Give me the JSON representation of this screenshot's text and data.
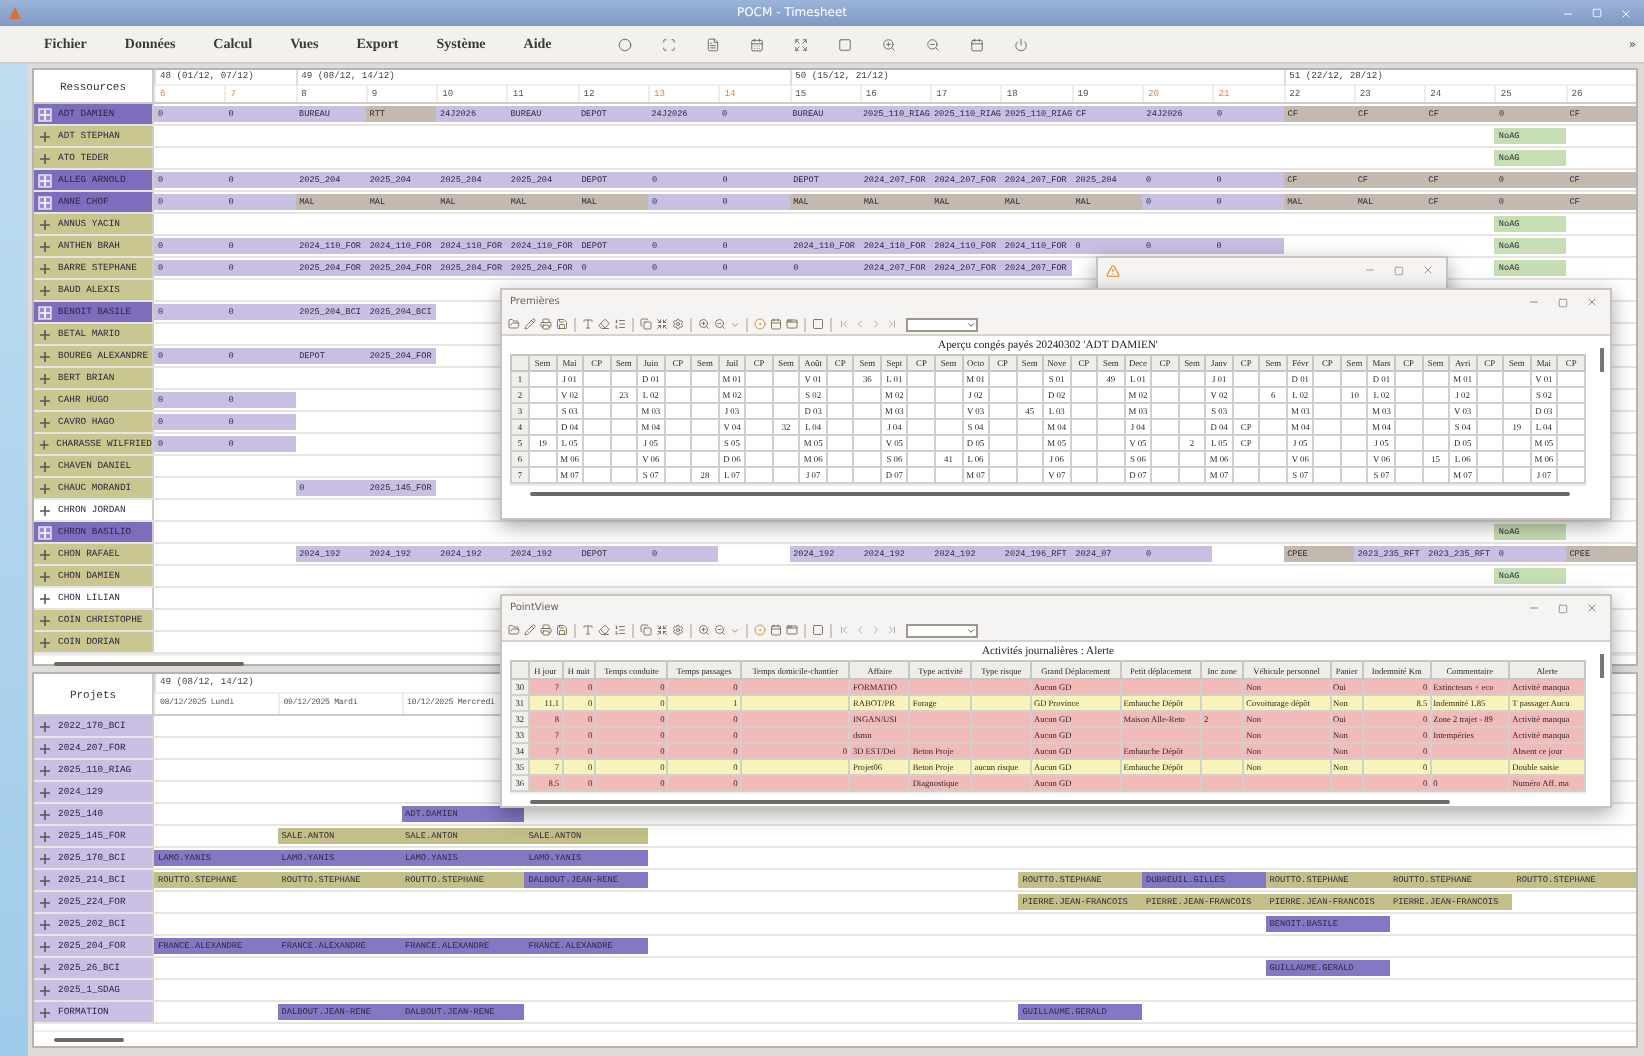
{
  "main_window": {
    "title": "POCM - Timesheet",
    "menu": [
      "Fichier",
      "Données",
      "Calcul",
      "Vues",
      "Export",
      "Système",
      "Aide"
    ],
    "overflow": "»"
  },
  "resources": {
    "label": "Ressources",
    "weeks": [
      {
        "label": "48 (01/12, 07/12)",
        "days": [
          {
            "label": "6",
            "weekend": true
          },
          {
            "label": "7",
            "weekend": true
          }
        ]
      },
      {
        "label": "49 (08/12, 14/12)",
        "days": [
          {
            "label": "8",
            "weekend": false
          },
          {
            "label": "9",
            "weekend": false
          },
          {
            "label": "10",
            "weekend": false
          },
          {
            "label": "11",
            "weekend": false
          },
          {
            "label": "12",
            "weekend": false
          },
          {
            "label": "13",
            "weekend": true
          },
          {
            "label": "14",
            "weekend": true
          }
        ]
      },
      {
        "label": "50 (15/12, 21/12)",
        "days": [
          {
            "label": "15",
            "weekend": false
          },
          {
            "label": "16",
            "weekend": false
          },
          {
            "label": "17",
            "weekend": false
          },
          {
            "label": "18",
            "weekend": false
          },
          {
            "label": "19",
            "weekend": false
          },
          {
            "label": "20",
            "weekend": true
          },
          {
            "label": "21",
            "weekend": true
          }
        ]
      },
      {
        "label": "51 (22/12, 28/12)",
        "days": [
          {
            "label": "22",
            "weekend": false
          },
          {
            "label": "23",
            "weekend": false
          },
          {
            "label": "24",
            "weekend": false
          },
          {
            "label": "25",
            "weekend": false
          },
          {
            "label": "26",
            "weekend": false
          }
        ]
      }
    ],
    "rows": [
      {
        "name": "ADT DAMIEN",
        "kind": "highlighted",
        "cells": [
          {
            "kind": "task",
            "text": "0"
          },
          {
            "kind": "task",
            "text": "0"
          },
          {
            "kind": "task",
            "text": "BUREAU"
          },
          {
            "kind": "absence",
            "text": "RTT"
          },
          {
            "kind": "task",
            "text": "24J2026"
          },
          {
            "kind": "task",
            "text": "BUREAU"
          },
          {
            "kind": "task",
            "text": "DEPOT"
          },
          {
            "kind": "task",
            "text": "24J2026"
          },
          {
            "kind": "task",
            "text": "0"
          },
          {
            "kind": "task",
            "text": "BUREAU"
          },
          {
            "kind": "task",
            "text": "2025_110_RIAG"
          },
          {
            "kind": "task",
            "text": "2025_110_RIAG"
          },
          {
            "kind": "task",
            "text": "2025_110_RIAG"
          },
          {
            "kind": "task",
            "text": "CF"
          },
          {
            "kind": "task",
            "text": "24J2026"
          },
          {
            "kind": "task",
            "text": "0"
          },
          {
            "kind": "absence",
            "text": "CF"
          },
          {
            "kind": "absence",
            "text": "CF"
          },
          {
            "kind": "absence",
            "text": "CF"
          },
          {
            "kind": "absence",
            "text": "0"
          },
          {
            "kind": "absence",
            "text": "CF"
          }
        ]
      },
      {
        "name": "ADT STEPHAN",
        "kind": "assigned",
        "cells": [
          {
            "kind": "blank"
          },
          {
            "kind": "blank"
          },
          {
            "kind": "blank"
          },
          {
            "kind": "blank"
          },
          {
            "kind": "blank"
          },
          {
            "kind": "blank"
          },
          {
            "kind": "blank"
          },
          {
            "kind": "blank"
          },
          {
            "kind": "blank"
          },
          {
            "kind": "blank"
          },
          {
            "kind": "blank"
          },
          {
            "kind": "blank"
          },
          {
            "kind": "blank"
          },
          {
            "kind": "blank"
          },
          {
            "kind": "blank"
          },
          {
            "kind": "blank"
          },
          {
            "kind": "blank"
          },
          {
            "kind": "blank"
          },
          {
            "kind": "blank"
          },
          {
            "kind": "note",
            "text": "NoAG"
          }
        ]
      },
      {
        "name": "ATO TEDER",
        "kind": "assigned",
        "cells": [
          {
            "kind": "blank"
          },
          {
            "kind": "blank"
          },
          {
            "kind": "blank"
          },
          {
            "kind": "blank"
          },
          {
            "kind": "blank"
          },
          {
            "kind": "blank"
          },
          {
            "kind": "blank"
          },
          {
            "kind": "blank"
          },
          {
            "kind": "blank"
          },
          {
            "kind": "blank"
          },
          {
            "kind": "blank"
          },
          {
            "kind": "blank"
          },
          {
            "kind": "blank"
          },
          {
            "kind": "blank"
          },
          {
            "kind": "blank"
          },
          {
            "kind": "blank"
          },
          {
            "kind": "blank"
          },
          {
            "kind": "blank"
          },
          {
            "kind": "blank"
          },
          {
            "kind": "note",
            "text": "NoAG"
          }
        ]
      },
      {
        "name": "ALLEG ARNOLD",
        "kind": "highlighted",
        "cells": [
          {
            "kind": "task",
            "text": "0"
          },
          {
            "kind": "task",
            "text": "0"
          },
          {
            "kind": "task",
            "text": "2025_204"
          },
          {
            "kind": "task",
            "text": "2025_204"
          },
          {
            "kind": "task",
            "text": "2025_204"
          },
          {
            "kind": "task",
            "text": "2025_204"
          },
          {
            "kind": "task",
            "text": "DEPOT"
          },
          {
            "kind": "task",
            "text": "0"
          },
          {
            "kind": "task",
            "text": "0"
          },
          {
            "kind": "task",
            "text": "DEPOT"
          },
          {
            "kind": "task",
            "text": "2024_207_FOR"
          },
          {
            "kind": "task",
            "text": "2024_207_FOR"
          },
          {
            "kind": "task",
            "text": "2024_207_FOR"
          },
          {
            "kind": "task",
            "text": "2025_204"
          },
          {
            "kind": "task",
            "text": "0"
          },
          {
            "kind": "task",
            "text": "0"
          },
          {
            "kind": "absence",
            "text": "CF"
          },
          {
            "kind": "absence",
            "text": "CF"
          },
          {
            "kind": "absence",
            "text": "CF"
          },
          {
            "kind": "absence",
            "text": "0"
          },
          {
            "kind": "absence",
            "text": "CF"
          }
        ]
      },
      {
        "name": "ANNE CHOF",
        "kind": "highlighted",
        "cells": [
          {
            "kind": "task",
            "text": "0"
          },
          {
            "kind": "task",
            "text": "0"
          },
          {
            "kind": "absence",
            "text": "MAL"
          },
          {
            "kind": "absence",
            "text": "MAL"
          },
          {
            "kind": "absence",
            "text": "MAL"
          },
          {
            "kind": "absence",
            "text": "MAL"
          },
          {
            "kind": "absence",
            "text": "MAL"
          },
          {
            "kind": "task",
            "text": "0"
          },
          {
            "kind": "task",
            "text": "0"
          },
          {
            "kind": "absence",
            "text": "MAL"
          },
          {
            "kind": "absence",
            "text": "MAL"
          },
          {
            "kind": "absence",
            "text": "MAL"
          },
          {
            "kind": "absence",
            "text": "MAL"
          },
          {
            "kind": "absence",
            "text": "MAL"
          },
          {
            "kind": "task",
            "text": "0"
          },
          {
            "kind": "task",
            "text": "0"
          },
          {
            "kind": "absence",
            "text": "MAL"
          },
          {
            "kind": "absence",
            "text": "MAL"
          },
          {
            "kind": "absence",
            "text": "CF"
          },
          {
            "kind": "absence",
            "text": "0"
          },
          {
            "kind": "absence",
            "text": "CF"
          }
        ]
      },
      {
        "name": "ANNUS YACIN",
        "kind": "assigned",
        "cells": [
          {
            "kind": "blank"
          },
          {
            "kind": "blank"
          },
          {
            "kind": "blank"
          },
          {
            "kind": "blank"
          },
          {
            "kind": "blank"
          },
          {
            "kind": "blank"
          },
          {
            "kind": "blank"
          },
          {
            "kind": "blank"
          },
          {
            "kind": "blank"
          },
          {
            "kind": "blank"
          },
          {
            "kind": "blank"
          },
          {
            "kind": "blank"
          },
          {
            "kind": "blank"
          },
          {
            "kind": "blank"
          },
          {
            "kind": "blank"
          },
          {
            "kind": "blank"
          },
          {
            "kind": "blank"
          },
          {
            "kind": "blank"
          },
          {
            "kind": "blank"
          },
          {
            "kind": "note",
            "text": "NoAG"
          }
        ]
      },
      {
        "name": "ANTHEN BRAH",
        "kind": "assigned",
        "cells": [
          {
            "kind": "task",
            "text": "0"
          },
          {
            "kind": "task",
            "text": "0"
          },
          {
            "kind": "task",
            "text": "2024_110_FOR"
          },
          {
            "kind": "task",
            "text": "2024_110_FOR"
          },
          {
            "kind": "task",
            "text": "2024_110_FOR"
          },
          {
            "kind": "task",
            "text": "2024_110_FOR"
          },
          {
            "kind": "task",
            "text": "DEPOT"
          },
          {
            "kind": "task",
            "text": "0"
          },
          {
            "kind": "task",
            "text": "0"
          },
          {
            "kind": "task",
            "text": "2024_110_FOR"
          },
          {
            "kind": "task",
            "text": "2024_110_FOR"
          },
          {
            "kind": "task",
            "text": "2024_110_FOR"
          },
          {
            "kind": "task",
            "text": "2024_110_FOR"
          },
          {
            "kind": "task",
            "text": "0"
          },
          {
            "kind": "task",
            "text": "0"
          },
          {
            "kind": "task",
            "text": "0"
          },
          {
            "kind": "blank"
          },
          {
            "kind": "blank"
          },
          {
            "kind": "blank"
          },
          {
            "kind": "note",
            "text": "NoAG"
          }
        ]
      },
      {
        "name": "BARRE STEPHANE",
        "kind": "assigned",
        "cells": [
          {
            "kind": "task",
            "text": "0"
          },
          {
            "kind": "task",
            "text": "0"
          },
          {
            "kind": "task",
            "text": "2025_204_FOR"
          },
          {
            "kind": "task",
            "text": "2025_204_FOR"
          },
          {
            "kind": "task",
            "text": "2025_204_FOR"
          },
          {
            "kind": "task",
            "text": "2025_204_FOR"
          },
          {
            "kind": "task",
            "text": "0"
          },
          {
            "kind": "task",
            "text": "0"
          },
          {
            "kind": "task",
            "text": "0"
          },
          {
            "kind": "task",
            "text": "0"
          },
          {
            "kind": "task",
            "text": "2024_207_FOR"
          },
          {
            "kind": "task",
            "text": "2024_207_FOR"
          },
          {
            "kind": "task",
            "text": "2024_207_FOR"
          },
          {
            "kind": "blank"
          },
          {
            "kind": "blank"
          },
          {
            "kind": "blank"
          },
          {
            "kind": "blank"
          },
          {
            "kind": "blank"
          },
          {
            "kind": "blank"
          },
          {
            "kind": "note",
            "text": "NoAG"
          }
        ]
      },
      {
        "name": "BAUD ALEXIS",
        "kind": "assigned",
        "cells": []
      },
      {
        "name": "BENOIT BASILE",
        "kind": "highlighted",
        "cells": [
          {
            "kind": "task",
            "text": "0"
          },
          {
            "kind": "task",
            "text": "0"
          },
          {
            "kind": "task",
            "text": "2025_204_BCI"
          },
          {
            "kind": "task",
            "text": "2025_204_BCI"
          }
        ]
      },
      {
        "name": "BETAL MARIO",
        "kind": "assigned",
        "cells": []
      },
      {
        "name": "BOUREG ALEXANDRE",
        "kind": "assigned",
        "cells": [
          {
            "kind": "task",
            "text": "0"
          },
          {
            "kind": "task",
            "text": "0"
          },
          {
            "kind": "task",
            "text": "DEPOT"
          },
          {
            "kind": "task",
            "text": "2025_204_FOR"
          }
        ]
      },
      {
        "name": "BERT BRIAN",
        "kind": "assigned",
        "cells": []
      },
      {
        "name": "CAHR HUGO",
        "kind": "assigned",
        "cells": [
          {
            "kind": "task",
            "text": "0"
          },
          {
            "kind": "task",
            "text": "0"
          }
        ]
      },
      {
        "name": "CAVRO HAGO",
        "kind": "assigned",
        "cells": [
          {
            "kind": "task",
            "text": "0"
          },
          {
            "kind": "task",
            "text": "0"
          }
        ]
      },
      {
        "name": "CHARASSE WILFRIED",
        "kind": "assigned",
        "cells": [
          {
            "kind": "task",
            "text": "0"
          },
          {
            "kind": "task",
            "text": "0"
          }
        ]
      },
      {
        "name": "CHAVEN DANIEL",
        "kind": "assigned",
        "cells": []
      },
      {
        "name": "CHAUC MORANDI",
        "kind": "assigned",
        "cells": [
          {
            "kind": "blank"
          },
          {
            "kind": "blank"
          },
          {
            "kind": "task",
            "text": "0"
          },
          {
            "kind": "task",
            "text": "2025_145_FOR"
          }
        ]
      },
      {
        "name": "CHRON JORDAN",
        "kind": "unassigned",
        "cells": []
      },
      {
        "name": "CHRON BASILIO",
        "kind": "highlighted",
        "cells": [
          {
            "kind": "blank"
          },
          {
            "kind": "blank"
          },
          {
            "kind": "blank"
          },
          {
            "kind": "blank"
          },
          {
            "kind": "blank"
          },
          {
            "kind": "blank"
          },
          {
            "kind": "blank"
          },
          {
            "kind": "blank"
          },
          {
            "kind": "blank"
          },
          {
            "kind": "blank"
          },
          {
            "kind": "blank"
          },
          {
            "kind": "blank"
          },
          {
            "kind": "blank"
          },
          {
            "kind": "blank"
          },
          {
            "kind": "blank"
          },
          {
            "kind": "blank"
          },
          {
            "kind": "blank"
          },
          {
            "kind": "blank"
          },
          {
            "kind": "blank"
          },
          {
            "kind": "note",
            "text": "NoAG"
          }
        ]
      },
      {
        "name": "CHON RAFAEL",
        "kind": "assigned",
        "cells": [
          {
            "kind": "blank"
          },
          {
            "kind": "blank"
          },
          {
            "kind": "task",
            "text": "2024_192"
          },
          {
            "kind": "task",
            "text": "2024_192"
          },
          {
            "kind": "task",
            "text": "2024_192"
          },
          {
            "kind": "task",
            "text": "2024_192"
          },
          {
            "kind": "task",
            "text": "DEPOT"
          },
          {
            "kind": "task",
            "text": "0"
          },
          {
            "kind": "blank"
          },
          {
            "kind": "task",
            "text": "2024_192"
          },
          {
            "kind": "task",
            "text": "2024_192"
          },
          {
            "kind": "task",
            "text": "2024_192"
          },
          {
            "kind": "task",
            "text": "2024_196_RFT"
          },
          {
            "kind": "task",
            "text": "2024_07"
          },
          {
            "kind": "task",
            "text": "0"
          },
          {
            "kind": "blank"
          },
          {
            "kind": "absence",
            "text": "CPEE"
          },
          {
            "kind": "task",
            "text": "2023_235_RFT"
          },
          {
            "kind": "task",
            "text": "2023_235_RFT"
          },
          {
            "kind": "task",
            "text": "0"
          },
          {
            "kind": "absence",
            "text": "CPEE"
          }
        ]
      },
      {
        "name": "CHON DAMIEN",
        "kind": "assigned",
        "cells": [
          {
            "kind": "blank"
          },
          {
            "kind": "blank"
          },
          {
            "kind": "blank"
          },
          {
            "kind": "blank"
          },
          {
            "kind": "blank"
          },
          {
            "kind": "blank"
          },
          {
            "kind": "blank"
          },
          {
            "kind": "blank"
          },
          {
            "kind": "blank"
          },
          {
            "kind": "blank"
          },
          {
            "kind": "blank"
          },
          {
            "kind": "blank"
          },
          {
            "kind": "blank"
          },
          {
            "kind": "blank"
          },
          {
            "kind": "blank"
          },
          {
            "kind": "blank"
          },
          {
            "kind": "blank"
          },
          {
            "kind": "blank"
          },
          {
            "kind": "blank"
          },
          {
            "kind": "note",
            "text": "NoAG"
          }
        ]
      },
      {
        "name": "CHON LILIAN",
        "kind": "unassigned",
        "cells": []
      },
      {
        "name": "COIN CHRISTOPHE",
        "kind": "assigned",
        "cells": []
      },
      {
        "name": "COIN DORIAN",
        "kind": "assigned",
        "cells": []
      }
    ]
  },
  "projects": {
    "label": "Projets",
    "week": "49 (08/12, 14/12)",
    "days": [
      "08/12/2025 Lundi",
      "09/12/2025 Mardi",
      "10/12/2025 Mercredi"
    ],
    "rows": [
      {
        "name": "2022_170_BCI",
        "cells": []
      },
      {
        "name": "2024_207_FOR",
        "cells": []
      },
      {
        "name": "2025_110_RIAG",
        "cells": []
      },
      {
        "name": "2024_129",
        "cells": []
      },
      {
        "name": "2025_140",
        "cells": [
          {
            "kind": "blank"
          },
          {
            "kind": "blank"
          },
          {
            "kind": "staff",
            "text": "ADT.DAMIEN"
          }
        ]
      },
      {
        "name": "2025_145_FOR",
        "cells": [
          {
            "kind": "blank"
          },
          {
            "kind": "crew",
            "text": "SALE.ANTON"
          },
          {
            "kind": "crew",
            "text": "SALE.ANTON"
          },
          {
            "kind": "crew",
            "text": "SALE.ANTON"
          }
        ]
      },
      {
        "name": "2025_170_BCI",
        "cells": [
          {
            "kind": "staff",
            "text": "LAMO.YANIS"
          },
          {
            "kind": "staff",
            "text": "LAMO.YANIS"
          },
          {
            "kind": "staff",
            "text": "LAMO.YANIS"
          },
          {
            "kind": "staff",
            "text": "LAMO.YANIS"
          }
        ]
      },
      {
        "name": "2025_214_BCI",
        "cells": [
          {
            "kind": "crew",
            "text": "ROUTTO.STEPHANE"
          },
          {
            "kind": "crew",
            "text": "ROUTTO.STEPHANE"
          },
          {
            "kind": "crew",
            "text": "ROUTTO.STEPHANE"
          },
          {
            "kind": "staff",
            "text": "DALBOUT.JEAN-RENE"
          },
          {
            "kind": "blank"
          },
          {
            "kind": "blank"
          },
          {
            "kind": "blank"
          },
          {
            "kind": "crew",
            "text": "ROUTTO.STEPHANE"
          },
          {
            "kind": "staff",
            "text": "DUBREUIL.GILLES"
          },
          {
            "kind": "crew",
            "text": "ROUTTO.STEPHANE"
          },
          {
            "kind": "crew",
            "text": "ROUTTO.STEPHANE"
          },
          {
            "kind": "crew",
            "text": "ROUTTO.STEPHANE"
          }
        ]
      },
      {
        "name": "2025_224_FOR",
        "cells": [
          {
            "kind": "blank"
          },
          {
            "kind": "blank"
          },
          {
            "kind": "blank"
          },
          {
            "kind": "blank"
          },
          {
            "kind": "blank"
          },
          {
            "kind": "blank"
          },
          {
            "kind": "blank"
          },
          {
            "kind": "crew",
            "text": "PIERRE.JEAN-FRANCOIS"
          },
          {
            "kind": "crew",
            "text": "PIERRE.JEAN-FRANCOIS"
          },
          {
            "kind": "crew",
            "text": "PIERRE.JEAN-FRANCOIS"
          },
          {
            "kind": "crew",
            "text": "PIERRE.JEAN-FRANCOIS"
          }
        ]
      },
      {
        "name": "2025_202_BCI",
        "cells": [
          {
            "kind": "blank"
          },
          {
            "kind": "blank"
          },
          {
            "kind": "blank"
          },
          {
            "kind": "blank"
          },
          {
            "kind": "blank"
          },
          {
            "kind": "blank"
          },
          {
            "kind": "blank"
          },
          {
            "kind": "blank"
          },
          {
            "kind": "blank"
          },
          {
            "kind": "staff",
            "text": "BENOIT.BASILE"
          }
        ]
      },
      {
        "name": "2025_204_FOR",
        "cells": [
          {
            "kind": "staff",
            "text": "FRANCE.ALEXANDRE"
          },
          {
            "kind": "staff",
            "text": "FRANCE.ALEXANDRE"
          },
          {
            "kind": "staff",
            "text": "FRANCE.ALEXANDRE"
          },
          {
            "kind": "staff",
            "text": "FRANCE.ALEXANDRE"
          }
        ]
      },
      {
        "name": "2025_26_BCI",
        "cells": [
          {
            "kind": "blank"
          },
          {
            "kind": "blank"
          },
          {
            "kind": "blank"
          },
          {
            "kind": "blank"
          },
          {
            "kind": "blank"
          },
          {
            "kind": "blank"
          },
          {
            "kind": "blank"
          },
          {
            "kind": "blank"
          },
          {
            "kind": "blank"
          },
          {
            "kind": "staff",
            "text": "GUILLAUME.GERALD"
          }
        ]
      },
      {
        "name": "2025_1_SDAG",
        "cells": []
      },
      {
        "name": "FORMATION",
        "cells": [
          {
            "kind": "blank"
          },
          {
            "kind": "staff",
            "text": "DALBOUT.JEAN-RENE"
          },
          {
            "kind": "staff",
            "text": "DALBOUT.JEAN-RENE"
          },
          {
            "kind": "blank"
          },
          {
            "kind": "blank"
          },
          {
            "kind": "blank"
          },
          {
            "kind": "blank"
          },
          {
            "kind": "staff",
            "text": "GUILLAUME.GERALD"
          }
        ]
      }
    ]
  },
  "warning_window": {
    "shown": true
  },
  "leave_window": {
    "title": "Premières",
    "heading": "Aperçu congés payés 20240302   'ADT DAMIEN'",
    "columns": [
      {
        "week": "Sem",
        "month": "Mai",
        "cp": "CP"
      },
      {
        "week": "Sem",
        "month": "Juin",
        "cp": "CP"
      },
      {
        "week": "Sem",
        "month": "Juil",
        "cp": "CP"
      },
      {
        "week": "Sem",
        "month": "Août",
        "cp": "CP"
      },
      {
        "week": "Sem",
        "month": "Sept",
        "cp": "CP"
      },
      {
        "week": "Sem",
        "month": "Octo",
        "cp": "CP"
      },
      {
        "week": "Sem",
        "month": "Nove",
        "cp": "CP"
      },
      {
        "week": "Sem",
        "month": "Dece",
        "cp": "CP"
      },
      {
        "week": "Sem",
        "month": "Janv",
        "cp": "CP"
      },
      {
        "week": "Sem",
        "month": "Févr",
        "cp": "CP"
      },
      {
        "week": "Sem",
        "month": "Mars",
        "cp": "CP"
      },
      {
        "week": "Sem",
        "month": "Avri",
        "cp": "CP"
      },
      {
        "week": "Sem",
        "month": "Mai",
        "cp": "CP"
      }
    ],
    "rows": [
      {
        "number": "1",
        "cells": [
          {
            "day": "J 01"
          },
          {
            "day": "D 01"
          },
          {
            "day": "M 01"
          },
          {
            "day": "V 01"
          },
          {
            "week": "36",
            "day": "L 01"
          },
          {
            "day": "M 01"
          },
          {
            "day": "S 01"
          },
          {
            "week": "49",
            "day": "L 01"
          },
          {
            "day": "J 01"
          },
          {
            "day": "D 01"
          },
          {
            "day": "D 01"
          },
          {
            "day": "M 01"
          },
          {
            "day": "V 01"
          }
        ]
      },
      {
        "number": "2",
        "cells": [
          {
            "day": "V 02"
          },
          {
            "week": "23",
            "day": "L 02"
          },
          {
            "day": "M 02"
          },
          {
            "day": "S 02"
          },
          {
            "day": "M 02"
          },
          {
            "day": "J 02"
          },
          {
            "day": "D 02"
          },
          {
            "day": "M 02"
          },
          {
            "day": "V 02"
          },
          {
            "week": "6",
            "day": "L 02"
          },
          {
            "week": "10",
            "day": "L 02"
          },
          {
            "day": "J 02"
          },
          {
            "day": "S 02"
          }
        ]
      },
      {
        "number": "3",
        "cells": [
          {
            "day": "S 03"
          },
          {
            "day": "M 03"
          },
          {
            "day": "J 03"
          },
          {
            "day": "D 03"
          },
          {
            "day": "M 03"
          },
          {
            "day": "V 03"
          },
          {
            "week": "45",
            "day": "L 03"
          },
          {
            "day": "M 03"
          },
          {
            "day": "S 03"
          },
          {
            "day": "M 03"
          },
          {
            "day": "M 03"
          },
          {
            "day": "V 03"
          },
          {
            "day": "D 03"
          }
        ]
      },
      {
        "number": "4",
        "cells": [
          {
            "day": "D 04"
          },
          {
            "day": "M 04"
          },
          {
            "day": "V 04"
          },
          {
            "week": "32",
            "day": "L 04"
          },
          {
            "day": "J 04"
          },
          {
            "day": "S 04"
          },
          {
            "day": "M 04"
          },
          {
            "day": "J 04"
          },
          {
            "day": "D 04",
            "cp": "CP"
          },
          {
            "day": "M 04"
          },
          {
            "day": "M 04"
          },
          {
            "day": "S 04"
          },
          {
            "week": "19",
            "day": "L 04"
          }
        ]
      },
      {
        "number": "5",
        "cells": [
          {
            "week": "19",
            "day": "L 05"
          },
          {
            "day": "J 05"
          },
          {
            "day": "S 05"
          },
          {
            "day": "M 05"
          },
          {
            "day": "V 05"
          },
          {
            "day": "D 05"
          },
          {
            "day": "M 05"
          },
          {
            "day": "V 05"
          },
          {
            "week": "2",
            "day": "L 05",
            "cp": "CP"
          },
          {
            "day": "J 05"
          },
          {
            "day": "J 05"
          },
          {
            "day": "D 05"
          },
          {
            "day": "M 05"
          }
        ]
      },
      {
        "number": "6",
        "cells": [
          {
            "day": "M 06"
          },
          {
            "day": "V 06"
          },
          {
            "day": "D 06"
          },
          {
            "day": "M 06"
          },
          {
            "day": "S 06"
          },
          {
            "week": "41",
            "day": "L 06"
          },
          {
            "day": "J 06"
          },
          {
            "day": "S 06"
          },
          {
            "day": "M 06"
          },
          {
            "day": "V 06"
          },
          {
            "day": "V 06"
          },
          {
            "week": "15",
            "day": "L 06"
          },
          {
            "day": "M 06"
          }
        ]
      },
      {
        "number": "7",
        "cells": [
          {
            "day": "M 07"
          },
          {
            "day": "S 07"
          },
          {
            "week": "28",
            "day": "L 07"
          },
          {
            "day": "J 07"
          },
          {
            "day": "D 07"
          },
          {
            "day": "M 07"
          },
          {
            "day": "V 07"
          },
          {
            "day": "D 07"
          },
          {
            "day": "M 07"
          },
          {
            "day": "S 07"
          },
          {
            "day": "S 07"
          },
          {
            "day": "M 07"
          },
          {
            "day": "J 07"
          }
        ]
      }
    ]
  },
  "alert_window": {
    "title": "PointView",
    "heading": "Activités journalières : Alerte",
    "columns": [
      "H jour",
      "H nuit",
      "Temps conduite",
      "Temps passages",
      "Temps domicile-chantier",
      "Affaire",
      "Type activité",
      "Type risque",
      "Grand Déplacement",
      "Petit déplacement",
      "Inc zone",
      "Véhicule personnel",
      "Panier",
      "Indemnité Km",
      "Commentaire",
      "Alerte"
    ],
    "rows": [
      {
        "number": "30",
        "kind": "error",
        "h_jour": "7",
        "h_nuit": "0",
        "temps_conduite": "0",
        "temps_passages": "0",
        "affaire": "FORMATIO",
        "grand_deplacement": "Aucun GD",
        "vehicule_personnel": "Non",
        "panier": "Oui",
        "indemnite_km": "0",
        "commentaire": "Extincteurs + eco",
        "alerte": "Activité manqua"
      },
      {
        "number": "31",
        "kind": "warning",
        "h_jour": "11.1",
        "h_nuit": "0",
        "temps_conduite": "0",
        "temps_passages": "1",
        "affaire": "RABOT/PR",
        "type_activite": "Forage",
        "grand_deplacement": "GD Province",
        "petit_deplacement": "Embauche Dépôt",
        "vehicule_personnel": "Covoiturage dépôt",
        "panier": "Non",
        "indemnite_km": "8.5",
        "commentaire": "Indemnité 1.85",
        "alerte": "T passager Aucu"
      },
      {
        "number": "32",
        "kind": "error",
        "h_jour": "8",
        "h_nuit": "0",
        "temps_conduite": "0",
        "temps_passages": "0",
        "affaire": "INGAN/USI",
        "grand_deplacement": "Aucun GD",
        "petit_deplacement": "Maison Alle-Reto",
        "inc_zone": "2",
        "vehicule_personnel": "Non",
        "panier": "Oui",
        "indemnite_km": "0",
        "commentaire": "Zone 2 trajet - 89",
        "alerte": "Activité manqua"
      },
      {
        "number": "33",
        "kind": "error",
        "h_jour": "7",
        "h_nuit": "0",
        "temps_conduite": "0",
        "temps_passages": "0",
        "affaire": "dsmn",
        "grand_deplacement": "Aucun GD",
        "vehicule_personnel": "Non",
        "panier": "Non",
        "indemnite_km": "0",
        "commentaire": "Intempéries",
        "alerte": "Activité manqua"
      },
      {
        "number": "34",
        "kind": "error",
        "h_jour": "7",
        "h_nuit": "0",
        "temps_conduite": "0",
        "temps_passages": "0",
        "temps_domicile": "0",
        "affaire": "3D EST/Dei",
        "type_activite": "Beton Proje",
        "grand_deplacement": "Aucun GD",
        "petit_deplacement": "Embauche Dépôt",
        "vehicule_personnel": "Non",
        "panier": "Non",
        "indemnite_km": "0",
        "alerte": "Absent ce jour"
      },
      {
        "number": "35",
        "kind": "warning",
        "h_jour": "7",
        "h_nuit": "0",
        "temps_conduite": "0",
        "temps_passages": "0",
        "affaire": "Projet06",
        "type_activite": "Beton Proje",
        "type_risque": "aucun risque",
        "grand_deplacement": "Aucun GD",
        "petit_deplacement": "Embauche Dépôt",
        "vehicule_personnel": "Non",
        "panier": "Non",
        "indemnite_km": "0",
        "alerte": "Double saisie"
      },
      {
        "number": "36",
        "kind": "error",
        "h_jour": "8.5",
        "h_nuit": "0",
        "temps_conduite": "0",
        "temps_passages": "0",
        "type_activite": "Diagnostique",
        "grand_deplacement": "Aucun GD",
        "indemnite_km": "0",
        "commentaire": "0",
        "alerte": "Numéro Aff. ma"
      }
    ]
  }
}
